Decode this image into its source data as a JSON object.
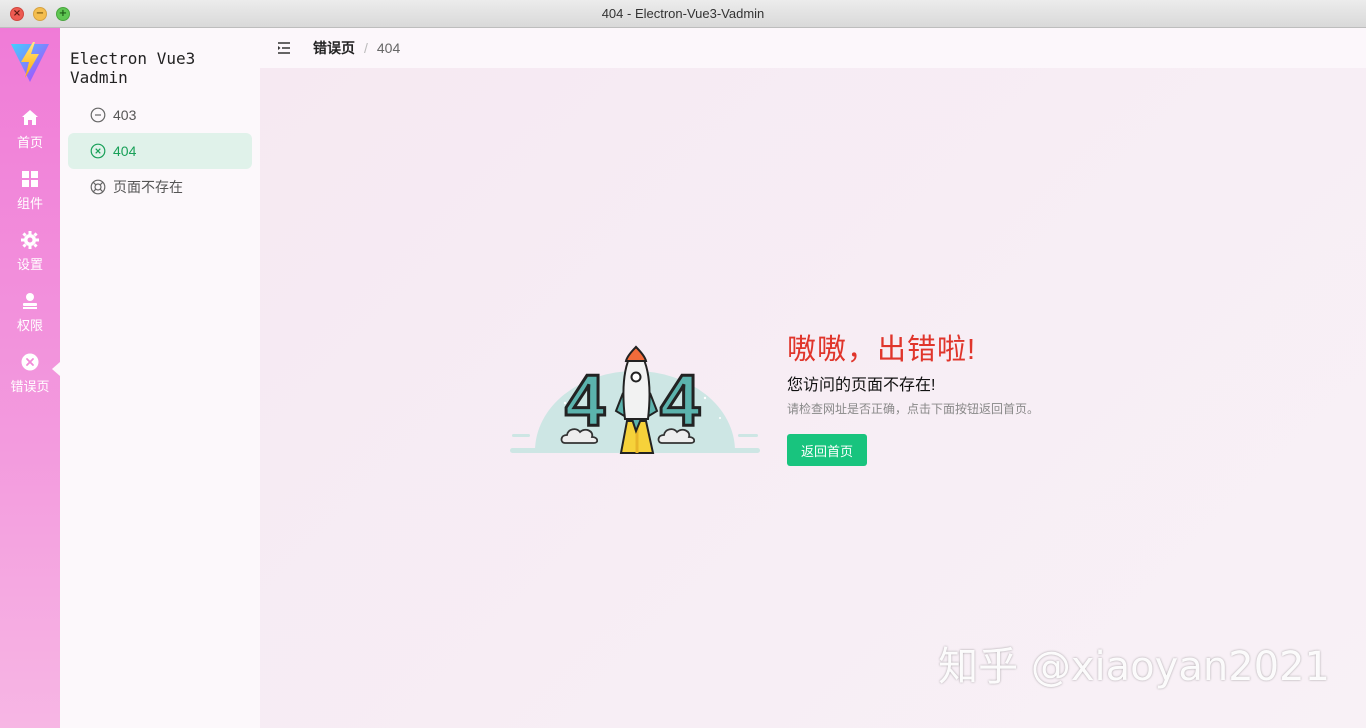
{
  "window": {
    "title": "404 - Electron-Vue3-Vadmin",
    "close_glyph": "×",
    "minimize_glyph": "−",
    "maximize_glyph": "+"
  },
  "rail": {
    "items": [
      {
        "label": "首页",
        "icon": "home-icon"
      },
      {
        "label": "组件",
        "icon": "grid-icon"
      },
      {
        "label": "设置",
        "icon": "gear-icon"
      },
      {
        "label": "权限",
        "icon": "user-icon"
      },
      {
        "label": "错误页",
        "icon": "close-circle-icon",
        "active": true
      }
    ]
  },
  "sidebar": {
    "app_name": "Electron Vue3 Vadmin",
    "items": [
      {
        "label": "403",
        "icon": "minus-circle-icon"
      },
      {
        "label": "404",
        "icon": "close-circle-icon",
        "active": true
      },
      {
        "label": "页面不存在",
        "icon": "lifebuoy-icon"
      }
    ]
  },
  "breadcrumb": {
    "parent": "错误页",
    "separator": "/",
    "current": "404"
  },
  "error": {
    "title": "嗷嗷，出错啦!",
    "subtitle": "您访问的页面不存在!",
    "description": "请检查网址是否正确，点击下面按钮返回首页。",
    "button_label": "返回首页"
  },
  "illustration": {
    "digit_left": "4",
    "digit_right": "4"
  },
  "watermark": "知乎 @xiaoyan2021",
  "colors": {
    "accent": "#18a058",
    "button": "#18c47e",
    "error_title": "#e0352b",
    "rail_top": "#f07bd7",
    "rail_bottom": "#f7b6e4"
  }
}
